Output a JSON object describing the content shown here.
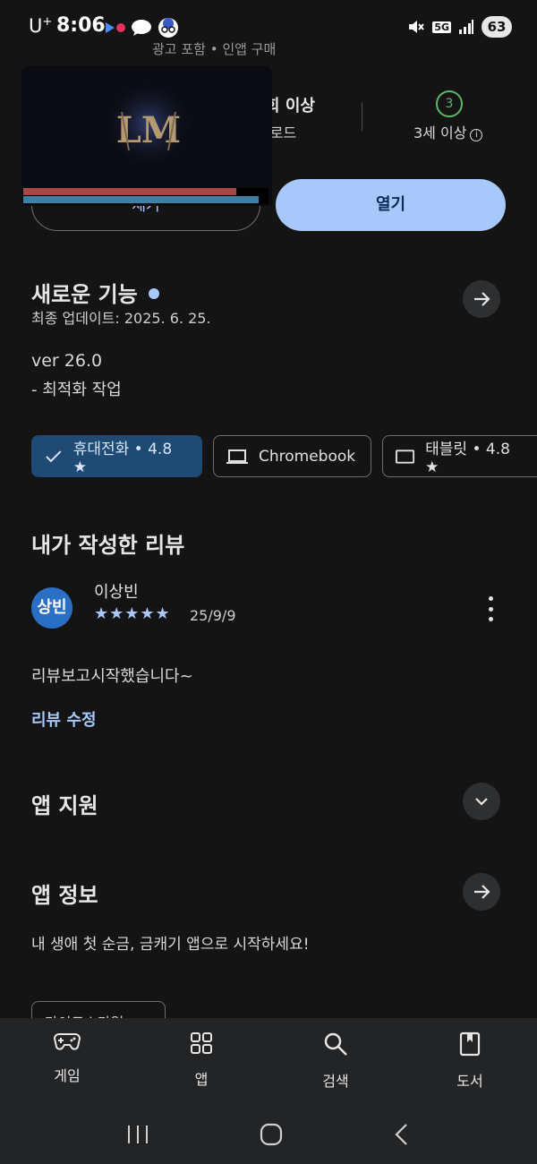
{
  "status_bar": {
    "carrier": "U",
    "carrier_sup": "+",
    "time": "8:06",
    "network": "5G",
    "battery": "63"
  },
  "header": {
    "sub_text": "광고 포함 • 인앱 구매",
    "downloads_top": "회 이상",
    "downloads_sub": "-로드",
    "age_badge": "3",
    "age_label": "3세 이상",
    "info_glyph": "i"
  },
  "actions": {
    "uninstall_label": "제거",
    "open_label": "열기"
  },
  "video": {
    "logo_text": "LM",
    "progress_red": 0.87,
    "progress_blue": 0.96
  },
  "whats_new": {
    "title": "새로운 기능",
    "updated": "최종 업데이트: 2025. 6. 25.",
    "version": "ver 26.0",
    "note": "- 최적화 작업"
  },
  "devices": [
    {
      "label": "휴대전화 • 4.8 ★",
      "icon": "check-icon"
    },
    {
      "label": "Chromebook",
      "icon": "laptop-icon"
    },
    {
      "label": "태블릿 • 4.8 ★",
      "icon": "tablet-icon"
    }
  ],
  "review": {
    "title": "내가 작성한 리뷰",
    "avatar_text": "상빈",
    "reviewer": "이상빈",
    "stars": "★★★★★",
    "date": "25/9/9",
    "text": "리뷰보고시작했습니다~",
    "edit_label": "리뷰 수정"
  },
  "app_support": {
    "title": "앱 지원"
  },
  "app_info": {
    "title": "앱 정보",
    "description": "내 생애 첫 순금, 금캐기 앱으로 시작하세요!",
    "tag": "라이트스타일"
  },
  "bottom_nav": [
    {
      "label": "게임",
      "icon": "gamepad-icon"
    },
    {
      "label": "앱",
      "icon": "apps-grid-icon"
    },
    {
      "label": "검색",
      "icon": "search-icon"
    },
    {
      "label": "도서",
      "icon": "book-icon"
    }
  ],
  "colors": {
    "background": "#141414",
    "accent": "#a8c7fa",
    "selected_chip": "#1f4a73"
  }
}
